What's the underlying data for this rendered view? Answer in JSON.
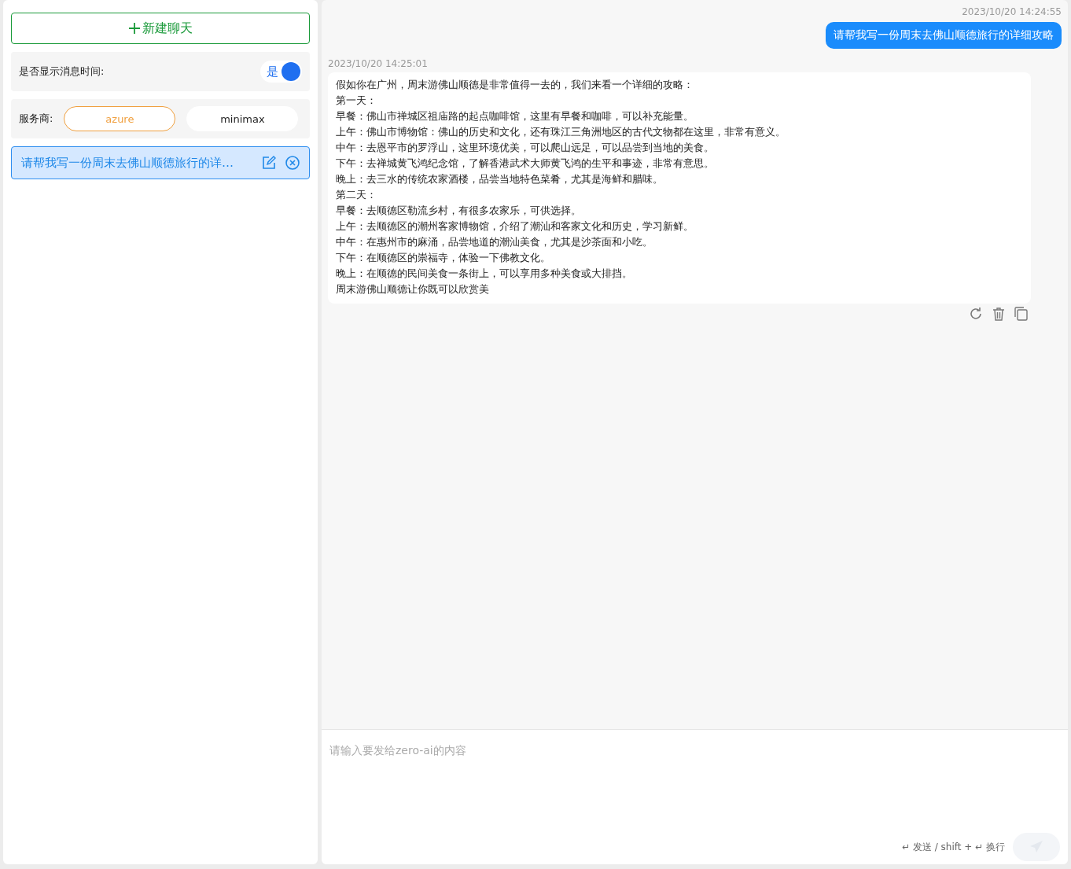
{
  "sidebar": {
    "new_chat_button": {
      "label": "新建聊天"
    },
    "show_time": {
      "label": "是否显示消息时间:",
      "toggle_label": "是",
      "on": true
    },
    "provider": {
      "label": "服务商:",
      "options": [
        {
          "label": "azure",
          "selected": true
        },
        {
          "label": "minimax",
          "selected": false
        }
      ]
    },
    "chats": [
      {
        "title": "请帮我写一份周末去佛山顺德旅行的详…",
        "selected": true
      }
    ]
  },
  "messages": [
    {
      "kind": "user",
      "time": "2023/10/20 14:24:55",
      "lines": [
        "请帮我写一份周末去佛山顺德旅行的详细攻略"
      ]
    },
    {
      "kind": "assistant",
      "time": "2023/10/20 14:25:01",
      "lines": [
        "假如你在广州，周末游佛山顺德是非常值得一去的，我们来看一个详细的攻略：",
        "第一天：",
        "早餐：佛山市禅城区祖庙路的起点咖啡馆，这里有早餐和咖啡，可以补充能量。",
        "上午：佛山市博物馆：佛山的历史和文化，还有珠江三角洲地区的古代文物都在这里，非常有意义。",
        "中午：去恩平市的罗浮山，这里环境优美，可以爬山远足，可以品尝到当地的美食。",
        "下午：去禅城黄飞鸿纪念馆，了解香港武术大师黄飞鸿的生平和事迹，非常有意思。",
        "晚上：去三水的传统农家酒楼，品尝当地特色菜肴，尤其是海鲜和腊味。",
        "第二天：",
        "早餐：去顺德区勒流乡村，有很多农家乐，可供选择。",
        "上午：去顺德区的潮州客家博物馆，介绍了潮汕和客家文化和历史，学习新鲜。",
        "中午：在惠州市的麻涌，品尝地道的潮汕美食，尤其是沙茶面和小吃。",
        "下午：在顺德区的崇福寺，体验一下佛教文化。",
        "晚上：在顺德的民间美食一条街上，可以享用多种美食或大排挡。",
        "周末游佛山顺德让你既可以欣赏美"
      ]
    }
  ],
  "composer": {
    "placeholder": "请输入要发给zero-ai的内容",
    "hint": "↵ 发送 / shift + ↵ 换行",
    "send_disabled": true
  }
}
